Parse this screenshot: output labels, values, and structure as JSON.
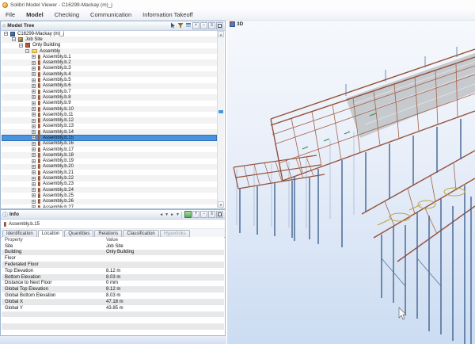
{
  "window": {
    "title": "Solibri Model Viewer - C16299-Mackay (m)_j"
  },
  "menu": {
    "items": [
      "File",
      "Model",
      "Checking",
      "Communication",
      "Information Takeoff"
    ]
  },
  "model_tree": {
    "title": "Model Tree",
    "selected_item": "Assembly.b.15",
    "items": [
      {
        "label": "C16299-Mackay (m)_j"
      },
      {
        "label": "Job Site"
      },
      {
        "label": "Only Building"
      },
      {
        "label": "Assembly"
      },
      {
        "label": "Assembly.b.1"
      },
      {
        "label": "Assembly.b.2"
      },
      {
        "label": "Assembly.b.3"
      },
      {
        "label": "Assembly.b.4"
      },
      {
        "label": "Assembly.b.5"
      },
      {
        "label": "Assembly.b.6"
      },
      {
        "label": "Assembly.b.7"
      },
      {
        "label": "Assembly.b.8"
      },
      {
        "label": "Assembly.b.9"
      },
      {
        "label": "Assembly.b.10"
      },
      {
        "label": "Assembly.b.11"
      },
      {
        "label": "Assembly.b.12"
      },
      {
        "label": "Assembly.b.13"
      },
      {
        "label": "Assembly.b.14"
      },
      {
        "label": "Assembly.b.15"
      },
      {
        "label": "Assembly.b.16"
      },
      {
        "label": "Assembly.b.17"
      },
      {
        "label": "Assembly.b.18"
      },
      {
        "label": "Assembly.b.19"
      },
      {
        "label": "Assembly.b.20"
      },
      {
        "label": "Assembly.b.21"
      },
      {
        "label": "Assembly.b.22"
      },
      {
        "label": "Assembly.b.23"
      },
      {
        "label": "Assembly.b.24"
      },
      {
        "label": "Assembly.b.25"
      },
      {
        "label": "Assembly.b.26"
      },
      {
        "label": "Assembly.b.27"
      }
    ]
  },
  "view3d": {
    "tab_label": "3D"
  },
  "info": {
    "title": "Info",
    "selected_item": "Assembly.b.15",
    "tabs": [
      {
        "label": "Identification"
      },
      {
        "label": "Location"
      },
      {
        "label": "Quantities"
      },
      {
        "label": "Relations"
      },
      {
        "label": "Classification"
      },
      {
        "label": "Hyperlinks"
      }
    ],
    "active_tab": "Location",
    "table": {
      "columns": [
        "Property",
        "Value"
      ],
      "rows": [
        [
          "Site",
          "Job Site"
        ],
        [
          "Building",
          "Only Building"
        ],
        [
          "Floor",
          ""
        ],
        [
          "Federated Floor",
          ""
        ],
        [
          "Top Elevation",
          "8.12 m"
        ],
        [
          "Bottom Elevation",
          "8.03 m"
        ],
        [
          "Distance to Next Floor",
          "0 mm"
        ],
        [
          "Global Top Elevation",
          "8.12 m"
        ],
        [
          "Global Bottom Elevation",
          "8.03 m"
        ],
        [
          "Global X",
          "47.18 m"
        ],
        [
          "Global Y",
          "43.85 m"
        ]
      ]
    }
  },
  "colors": {
    "selection": "#4795e2",
    "beam": "#94503a",
    "column": "#3f6290",
    "deck": "#c3c7cb",
    "viewport_bg_bottom": "#ccdcf2"
  }
}
